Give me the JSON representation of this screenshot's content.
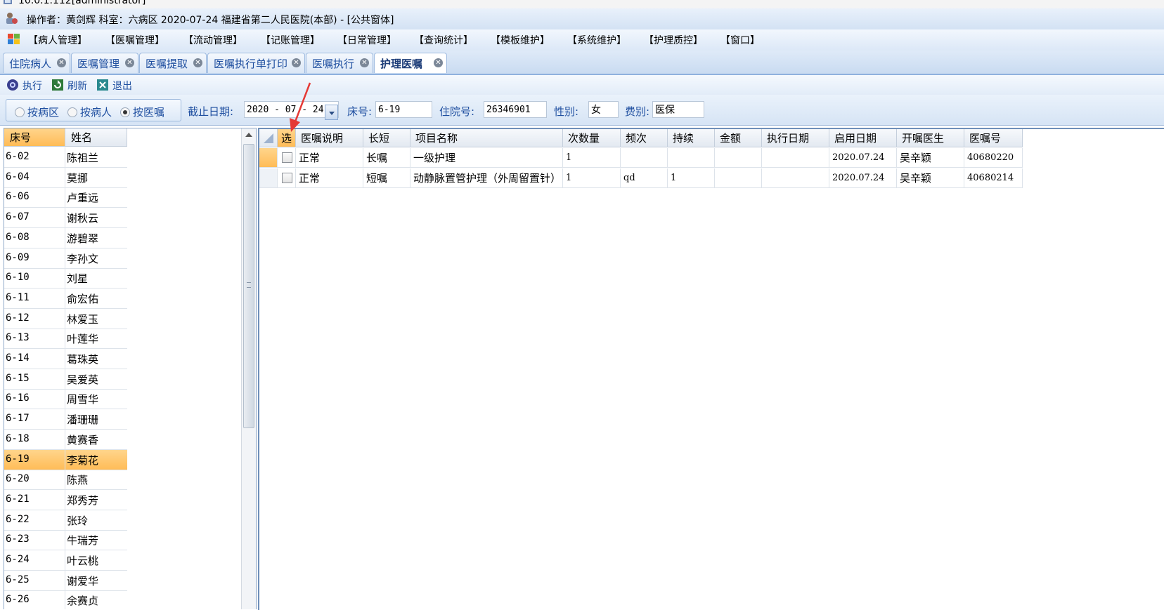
{
  "os_title": "10.0.1.112[administrator]",
  "app_title": "操作者：黄剑辉  科室：六病区  2020-07-24  福建省第二人民医院(本部) - [公共窗体]",
  "menu": [
    "【病人管理】",
    "【医嘱管理】",
    "【流动管理】",
    "【记账管理】",
    "【日常管理】",
    "【查询统计】",
    "【模板维护】",
    "【系统维护】",
    "【护理质控】",
    "【窗口】"
  ],
  "tabs": [
    "住院病人",
    "医嘱管理",
    "医嘱提取",
    "医嘱执行单打印",
    "医嘱执行",
    "护理医嘱"
  ],
  "toolbar": {
    "execute": "执行",
    "refresh": "刷新",
    "exit": "退出"
  },
  "filter": {
    "radio_ward": "按病区",
    "radio_patient": "按病人",
    "radio_order": "按医嘱",
    "selected": "按医嘱",
    "date_label": "截止日期:",
    "date_value": "2020 - 07 - 24",
    "bed_label": "床号:",
    "bed_value": "6-19",
    "admit_label": "住院号:",
    "admit_value": "26346901",
    "gender_label": "性别:",
    "gender_value": "女",
    "fee_label": "费别:",
    "fee_value": "医保"
  },
  "patient_list": {
    "headers": [
      "床号",
      "姓名"
    ],
    "selected_bed": "6-19",
    "rows": [
      [
        "6-02",
        "陈祖兰"
      ],
      [
        "6-04",
        "莫挪"
      ],
      [
        "6-06",
        "卢重远"
      ],
      [
        "6-07",
        "谢秋云"
      ],
      [
        "6-08",
        "游碧翠"
      ],
      [
        "6-09",
        "李孙文"
      ],
      [
        "6-10",
        "刘星"
      ],
      [
        "6-11",
        "俞宏佑"
      ],
      [
        "6-12",
        "林爱玉"
      ],
      [
        "6-13",
        "叶莲华"
      ],
      [
        "6-14",
        "葛珠英"
      ],
      [
        "6-15",
        "吴爱英"
      ],
      [
        "6-16",
        "周雪华"
      ],
      [
        "6-17",
        "潘珊珊"
      ],
      [
        "6-18",
        "黄赛香"
      ],
      [
        "6-19",
        "李菊花"
      ],
      [
        "6-20",
        "陈燕"
      ],
      [
        "6-21",
        "郑秀芳"
      ],
      [
        "6-22",
        "张玲"
      ],
      [
        "6-23",
        "牛瑞芳"
      ],
      [
        "6-24",
        "叶云桃"
      ],
      [
        "6-25",
        "谢爱华"
      ],
      [
        "6-26",
        "余赛贞"
      ]
    ]
  },
  "orders": {
    "headers": [
      "选",
      "医嘱说明",
      "长短",
      "项目名称",
      "次数量",
      "频次",
      "持续",
      "金额",
      "执行日期",
      "启用日期",
      "开嘱医生",
      "医嘱号"
    ],
    "rows": [
      [
        "",
        "正常",
        "长嘱",
        "一级护理",
        "1",
        "",
        "",
        "",
        "",
        "2020.07.24",
        "吴辛颖",
        "40680220"
      ],
      [
        "",
        "正常",
        "短嘱",
        "动静脉置管护理（外周留置针）",
        "1",
        "qd",
        "1",
        "",
        "",
        "2020.07.24",
        "吴辛颖",
        "40680214"
      ]
    ]
  },
  "colors": {
    "selected_row": "#ffc468",
    "accent": "#1f4fa0",
    "annotation_arrow": "#e53935"
  }
}
